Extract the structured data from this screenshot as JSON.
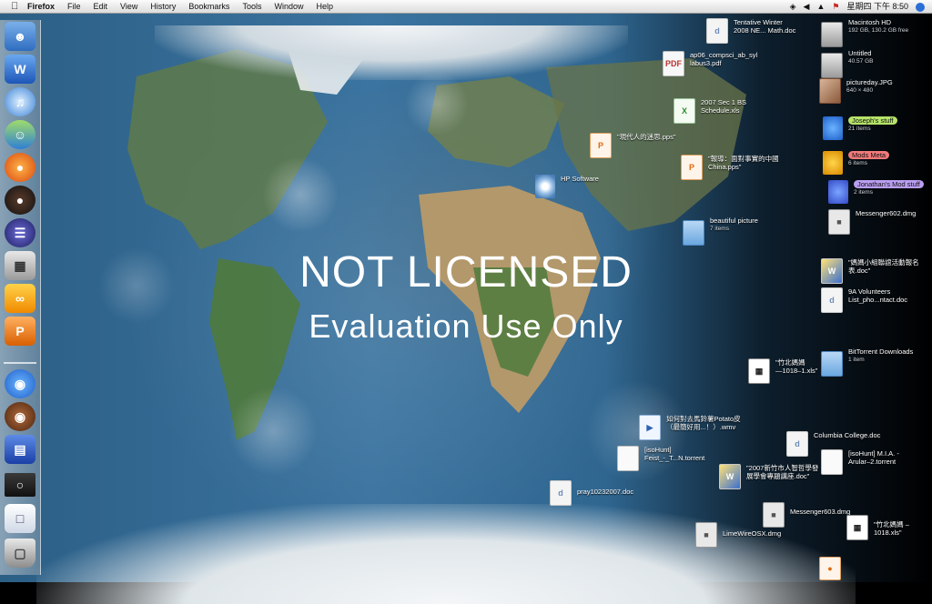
{
  "menubar": {
    "app": "Firefox",
    "menus": [
      "File",
      "Edit",
      "View",
      "History",
      "Bookmarks",
      "Tools",
      "Window",
      "Help"
    ],
    "clock": "星期四 下午 8:50"
  },
  "watermark": {
    "line1": "NOT LICENSED",
    "line2": "Evaluation Use Only"
  },
  "dock_icons": [
    "finder-icon",
    "word-icon",
    "itunes-icon",
    "msn-messenger-icon",
    "firefox-icon",
    "adium-icon",
    "eclipse-icon",
    "calculator-icon",
    "office-icon",
    "powerpoint-icon",
    "monster-icon",
    "stuffit-icon",
    "folder-stack-icon",
    "firefox-window-icon",
    "document-icon",
    "trash-icon"
  ],
  "desktop": {
    "tentative": {
      "l1": "Tentative Winter",
      "l2": "2008 NE... Math.doc"
    },
    "macintosh_hd": {
      "l1": "Macintosh HD",
      "sub": "192 GB, 130.2 GB free"
    },
    "ap06": {
      "l1": "ap06_compsci_ab_syl",
      "l2": "labus3.pdf"
    },
    "untitled": {
      "l1": "Untitled",
      "sub": "40.57 GB"
    },
    "pictureday": {
      "l1": "pictureday.JPG",
      "sub": "640 × 480"
    },
    "sec1": {
      "l1": "2007 Sec 1 BS",
      "l2": "Schedule.xls"
    },
    "josephs": {
      "l1": "Joseph's stuff",
      "sub": "21 items",
      "color": "#b6e36a"
    },
    "pps1": {
      "l1": "\"現代人的迷思.pps\""
    },
    "mods": {
      "l1": "Mods Meta",
      "sub": "6 items",
      "color": "#f07a7a"
    },
    "pps2": {
      "l1": "\"報導：面對事實的中國",
      "l2": "China.pps\""
    },
    "hp": {
      "l1": "HP Software"
    },
    "jonathans": {
      "l1": "Jonathan's Mod stuff",
      "sub": "2 items",
      "color": "#b99ef0"
    },
    "beautiful": {
      "l1": "beautiful picture",
      "sub": "7 items"
    },
    "messenger602": {
      "l1": "Messenger602.dmg"
    },
    "mama": {
      "l1": "\"媽媽小組聯誼活動報名",
      "l2": "表.doc\""
    },
    "volunteers": {
      "l1": "9A Volunteers",
      "l2": "List_pho...ntact.doc"
    },
    "bittorrent": {
      "l1": "BitTorrent Downloads",
      "sub": "1 item"
    },
    "zhubei": {
      "l1": "\"竹北媽媽",
      "l2": "—1018–1.xls\""
    },
    "potato": {
      "l1": "如何對去馬鈴薯Potato皮",
      "l2": "（最簡好用...！）.wmv"
    },
    "isohunt1": {
      "l1": "[isoHunt]",
      "l2": "Feist_-_T...N.torrent"
    },
    "columbia": {
      "l1": "Columbia College.doc"
    },
    "zhuren": {
      "l1": "\"2007新竹市人智哲學發",
      "l2": "展學會專題講座.doc\""
    },
    "isohunt2": {
      "l1": "[isoHunt] M.I.A. -",
      "l2": "Arular–2.torrent"
    },
    "pray": {
      "l1": "pray10232007.doc"
    },
    "messenger603": {
      "l1": "Messenger603.dmg"
    },
    "zhubei2": {
      "l1": "\"竹北媽媽 – 1018.xls\""
    },
    "limewire": {
      "l1": "LimeWireOSX.dmg"
    }
  }
}
